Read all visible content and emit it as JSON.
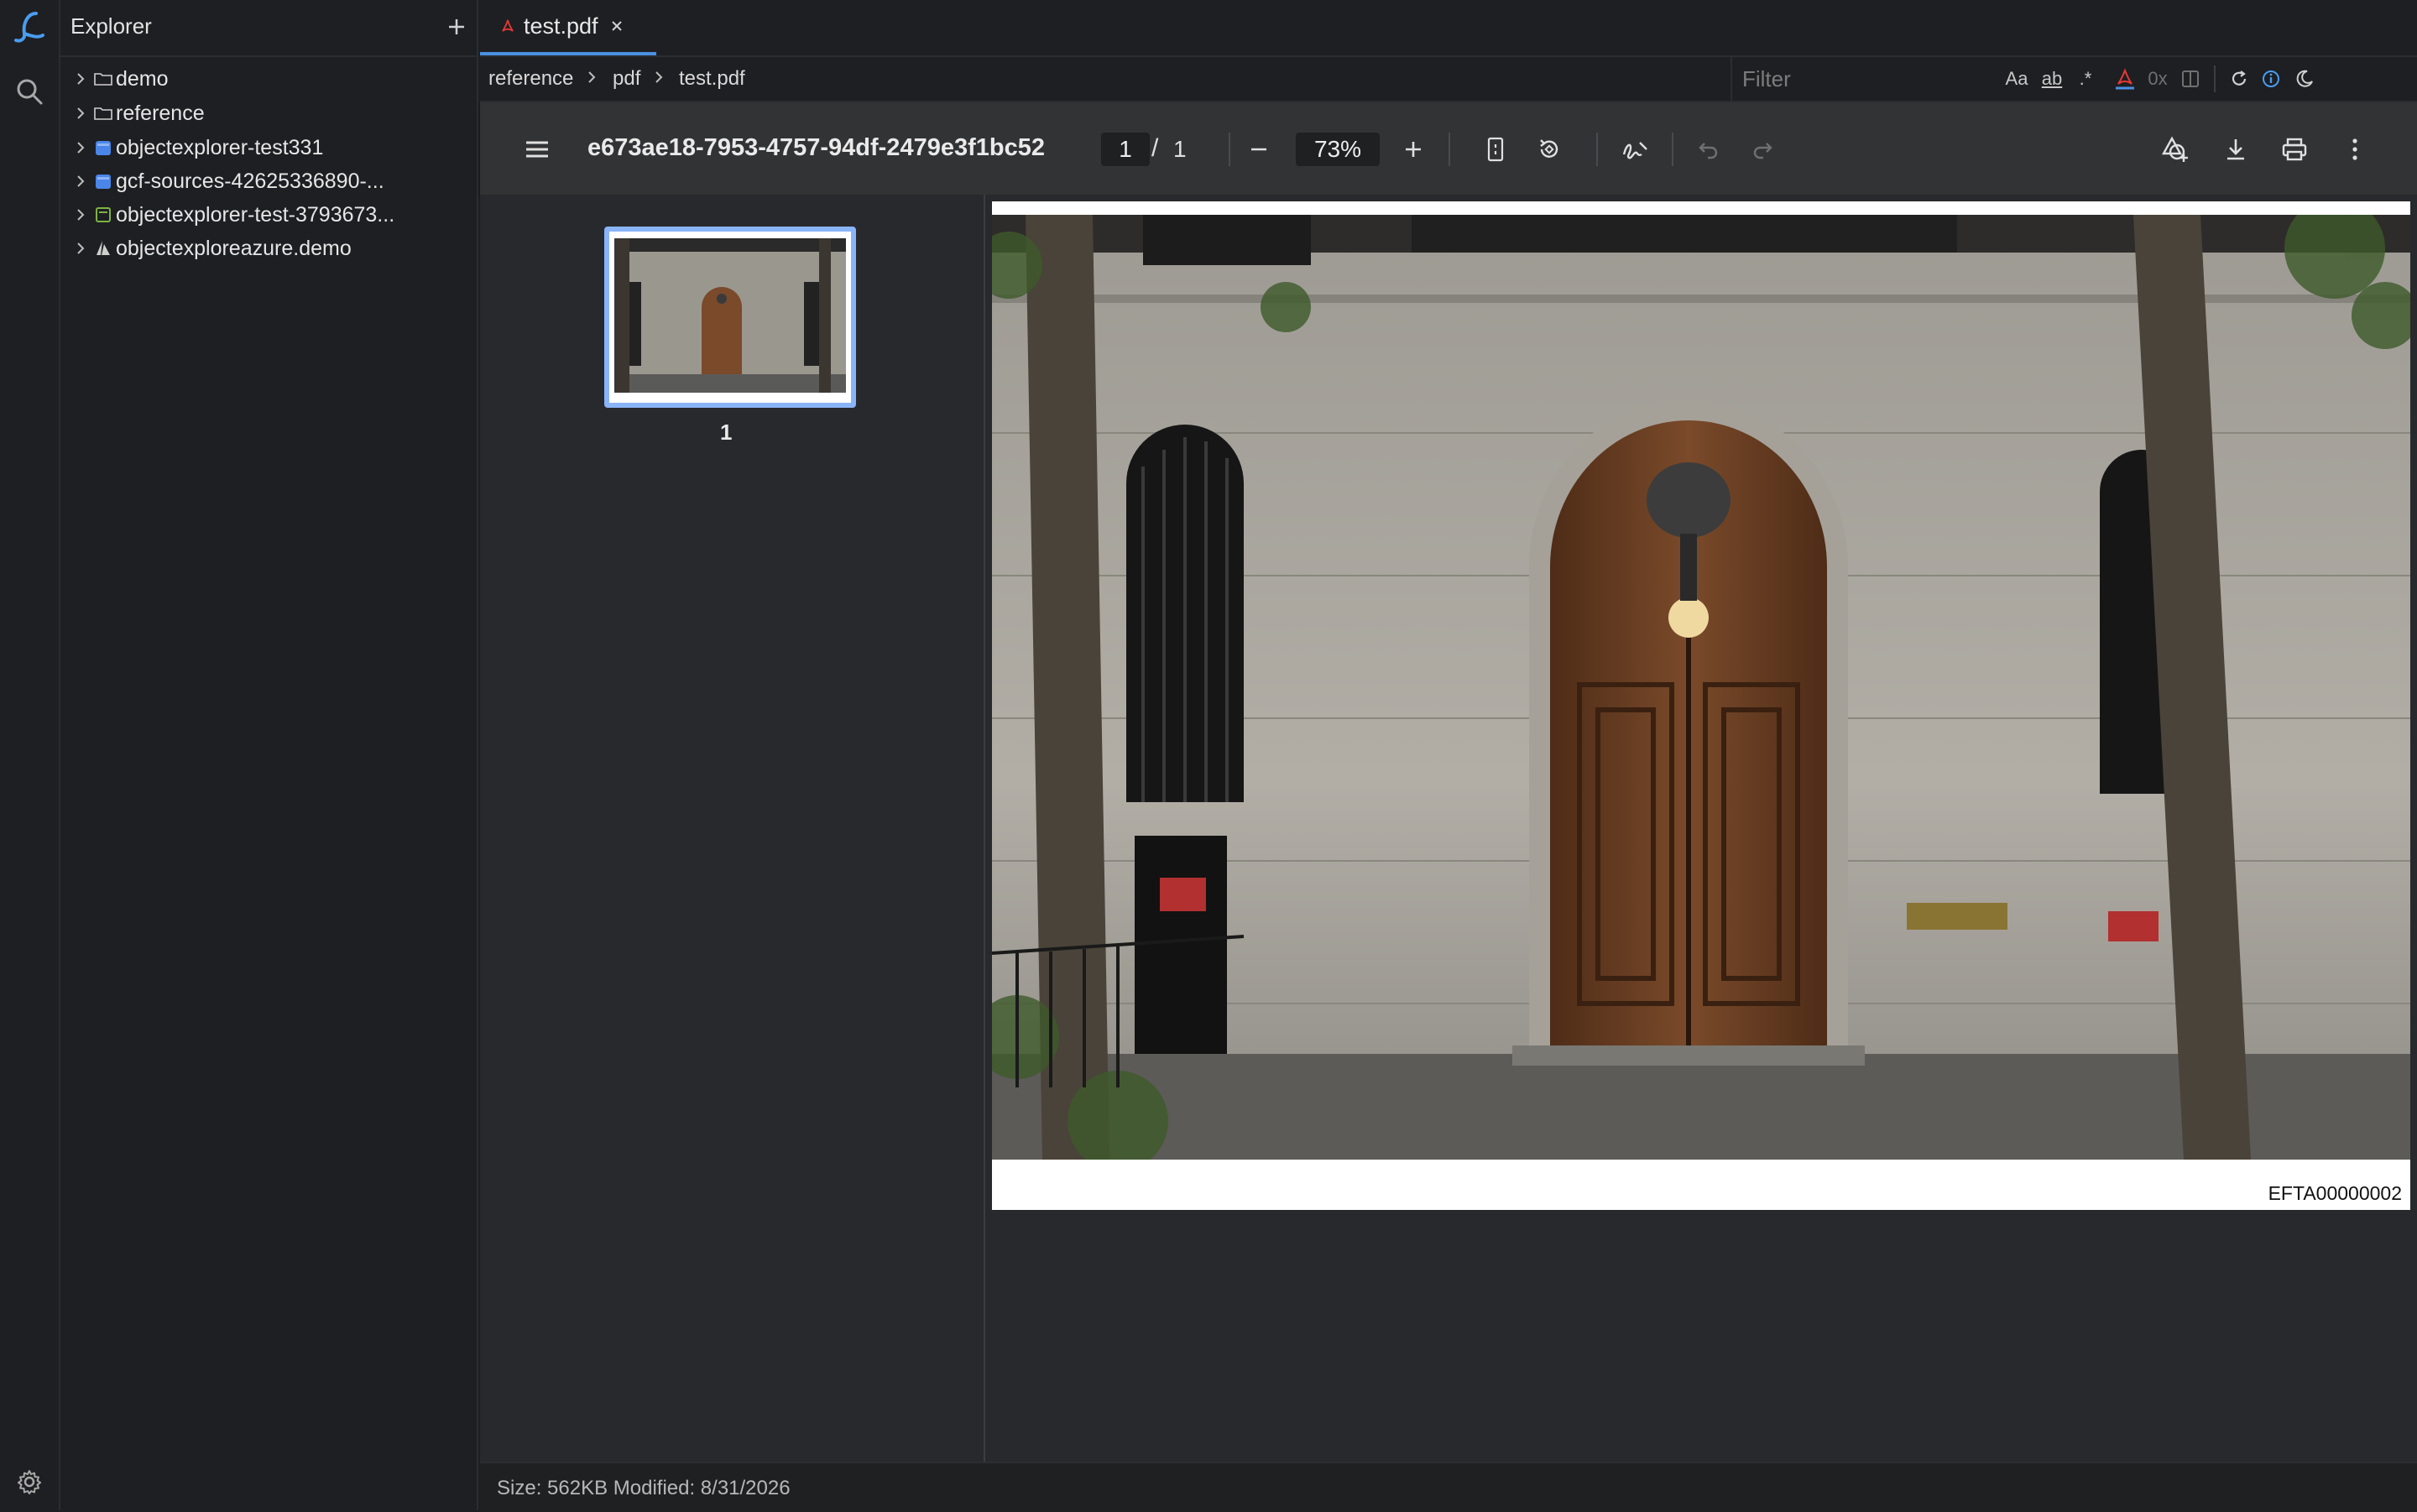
{
  "explorer": {
    "title": "Explorer",
    "items": [
      {
        "label": "demo",
        "icon": "folder-icon"
      },
      {
        "label": "reference",
        "icon": "folder-icon"
      },
      {
        "label": "objectexplorer-test331",
        "icon": "bucket-icon"
      },
      {
        "label": "gcf-sources-42625336890-...",
        "icon": "bucket-icon"
      },
      {
        "label": "objectexplorer-test-3793673...",
        "icon": "storage-icon"
      },
      {
        "label": "objectexploreazure.demo",
        "icon": "azure-icon"
      }
    ]
  },
  "tabs": [
    {
      "label": "test.pdf",
      "icon": "pdf-icon",
      "active": true
    }
  ],
  "breadcrumb": [
    "reference",
    "pdf",
    "test.pdf"
  ],
  "filter": {
    "placeholder": "Filter",
    "match_case": "Aa",
    "whole_word": "ab",
    "regex": ".*",
    "hex": "0x"
  },
  "pdf": {
    "title": "e673ae18-7953-4757-94df-2479e3f1bc52",
    "page_current": "1",
    "page_sep": "/",
    "page_total": "1",
    "zoom": "73%",
    "thumbnail_page": "1",
    "stamp": "EFTA00000002"
  },
  "status": {
    "text": "Size: 562KB Modified: 8/31/2026"
  },
  "colors": {
    "accent": "#4a90e2",
    "thumb_border": "#8ab4f8",
    "pdf_icon": "#e53935",
    "info_icon": "#4a9cf0"
  }
}
